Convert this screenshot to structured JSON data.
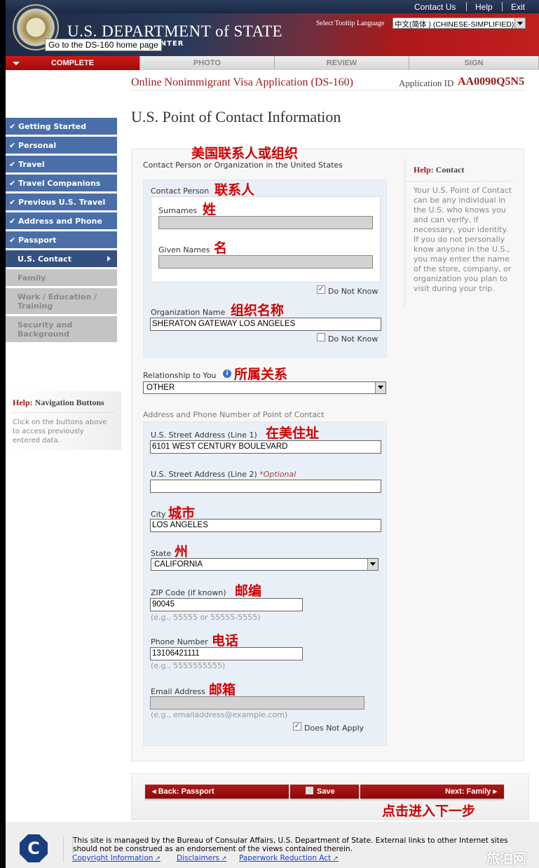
{
  "header": {
    "top_links": [
      "Contact Us",
      "Help",
      "Exit"
    ],
    "logo_title": "U.S. DEPARTMENT of STATE",
    "logo_subtitle": "NIC APPLICATION CENTER",
    "tooltip": "Go to the DS-160 home page",
    "tooltip_language_label": "Select Tooltip Language",
    "tooltip_language_value": "中文(简体 ) (CHINESE-SIMPLIFIED)"
  },
  "tabs": [
    {
      "label": "COMPLETE",
      "active": true
    },
    {
      "label": "PHOTO"
    },
    {
      "label": "REVIEW"
    },
    {
      "label": "SIGN"
    }
  ],
  "app": {
    "title": "Online Nonimmigrant Visa Application (DS-160)",
    "id_label": "Application ID",
    "id": "AA0090Q5N5"
  },
  "page_title": "U.S. Point of Contact Information",
  "sidebar": {
    "items": [
      {
        "label": "Getting Started",
        "state": "done"
      },
      {
        "label": "Personal",
        "state": "done"
      },
      {
        "label": "Travel",
        "state": "done"
      },
      {
        "label": "Travel Companions",
        "state": "done"
      },
      {
        "label": "Previous U.S. Travel",
        "state": "done"
      },
      {
        "label": "Address and Phone",
        "state": "done"
      },
      {
        "label": "Passport",
        "state": "done"
      },
      {
        "label": "U.S. Contact",
        "state": "current"
      },
      {
        "label": "Family",
        "state": "disabled"
      },
      {
        "label": "Work / Education / Training",
        "state": "disabled"
      },
      {
        "label": "Security and Background",
        "state": "disabled"
      }
    ],
    "help_title_prefix": "Help:",
    "help_title": "Navigation Buttons",
    "help_text": "Click on the buttons above to access previously entered data."
  },
  "help_contact": {
    "prefix": "Help:",
    "title": "Contact",
    "text": "Your U.S. Point of Contact can be any individual in the U.S. who knows you and can verify, if necessary, your identity. If you do not personally know anyone in the U.S., you may enter the name of the store, company, or organization you plan to visit during your trip."
  },
  "form": {
    "section1": "Contact Person or Organization in the United States",
    "contact_person": "Contact Person",
    "surnames_label": "Surnames",
    "surnames_value": "",
    "given_label": "Given Names",
    "given_value": "",
    "do_not_know": "Do Not Know",
    "person_do_not_know": true,
    "org_label": "Organization Name",
    "org_value": "SHERATON GATEWAY LOS ANGELES",
    "org_do_not_know": false,
    "relationship_label": "Relationship to You",
    "relationship_value": "OTHER",
    "section2": "Address and Phone Number of Point of Contact",
    "street1_label": "U.S. Street Address (Line 1)",
    "street1_value": "6101 WEST CENTURY BOULEVARD",
    "street2_label": "U.S. Street Address (Line 2)",
    "optional": "*Optional",
    "street2_value": "",
    "city_label": "City",
    "city_value": "LOS ANGELES",
    "state_label": "State",
    "state_value": "CALIFORNIA",
    "zip_label": "ZIP Code (if known)",
    "zip_value": "90045",
    "zip_hint": "(e.g., 55555 or 55555-5555)",
    "phone_label": "Phone Number",
    "phone_value": "13106421111",
    "phone_hint": "(e.g., 5555555555)",
    "email_label": "Email Address",
    "email_value": "",
    "email_hint": "(e.g., emailaddress@example.com)",
    "does_not_apply": "Does Not Apply",
    "email_does_not_apply": true
  },
  "annotations": {
    "section1": "美国联系人或组织",
    "contact_person": "联系人",
    "surnames": "姓",
    "given": "名",
    "org": "组织名称",
    "relationship": "所属关系",
    "street": "在美住址",
    "city": "城市",
    "state": "州",
    "zip": "邮编",
    "phone": "电话",
    "email": "邮箱",
    "next": "点击进入下一步"
  },
  "buttons": {
    "back": "Back: Passport",
    "save": "Save",
    "next": "Next: Family"
  },
  "footer": {
    "text": "This site is managed by the Bureau of Consular Affairs, U.S. Department of State. External links to other Internet sites should not be construed as an endorsement of the views contained therein.",
    "links": [
      "Copyright Information",
      "Disclaimers",
      "Paperwork Reduction Act"
    ],
    "seal_letter": "C",
    "watermark": "旅泊网"
  },
  "colors": {
    "accent_red": "#9a1a1a",
    "nav_blue": "#4a6ea8",
    "nav_current": "#34507f",
    "annotation_red": "#d00000"
  }
}
